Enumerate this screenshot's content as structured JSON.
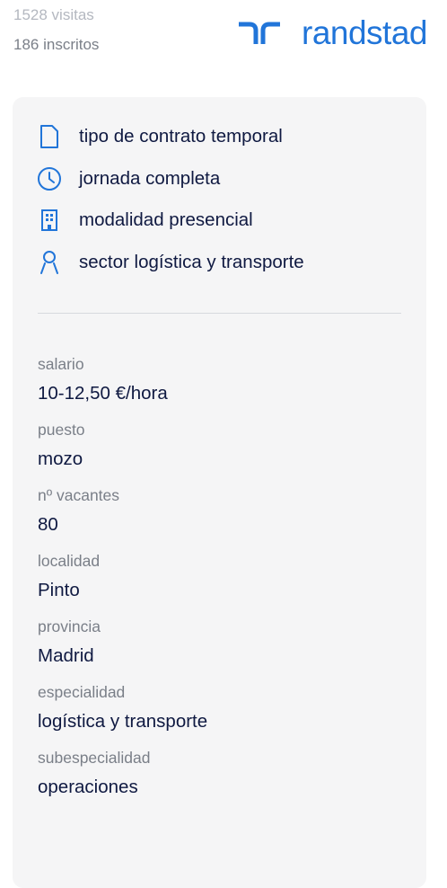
{
  "stats": {
    "visits": "1528 visitas",
    "enrolled": "186 inscritos"
  },
  "brand": {
    "name": "randstad",
    "color": "#2175d9"
  },
  "features": [
    {
      "icon": "document-icon",
      "text": "tipo de contrato temporal"
    },
    {
      "icon": "clock-icon",
      "text": "jornada completa"
    },
    {
      "icon": "building-icon",
      "text": "modalidad presencial"
    },
    {
      "icon": "person-icon",
      "text": "sector logística y transporte"
    }
  ],
  "details": [
    {
      "label": "salario",
      "value": "10-12,50 €/hora"
    },
    {
      "label": "puesto",
      "value": "mozo"
    },
    {
      "label": "nº vacantes",
      "value": "80"
    },
    {
      "label": "localidad",
      "value": "Pinto"
    },
    {
      "label": "provincia",
      "value": "Madrid"
    },
    {
      "label": "especialidad",
      "value": "logística y transporte"
    },
    {
      "label": "subespecialidad",
      "value": "operaciones"
    }
  ]
}
